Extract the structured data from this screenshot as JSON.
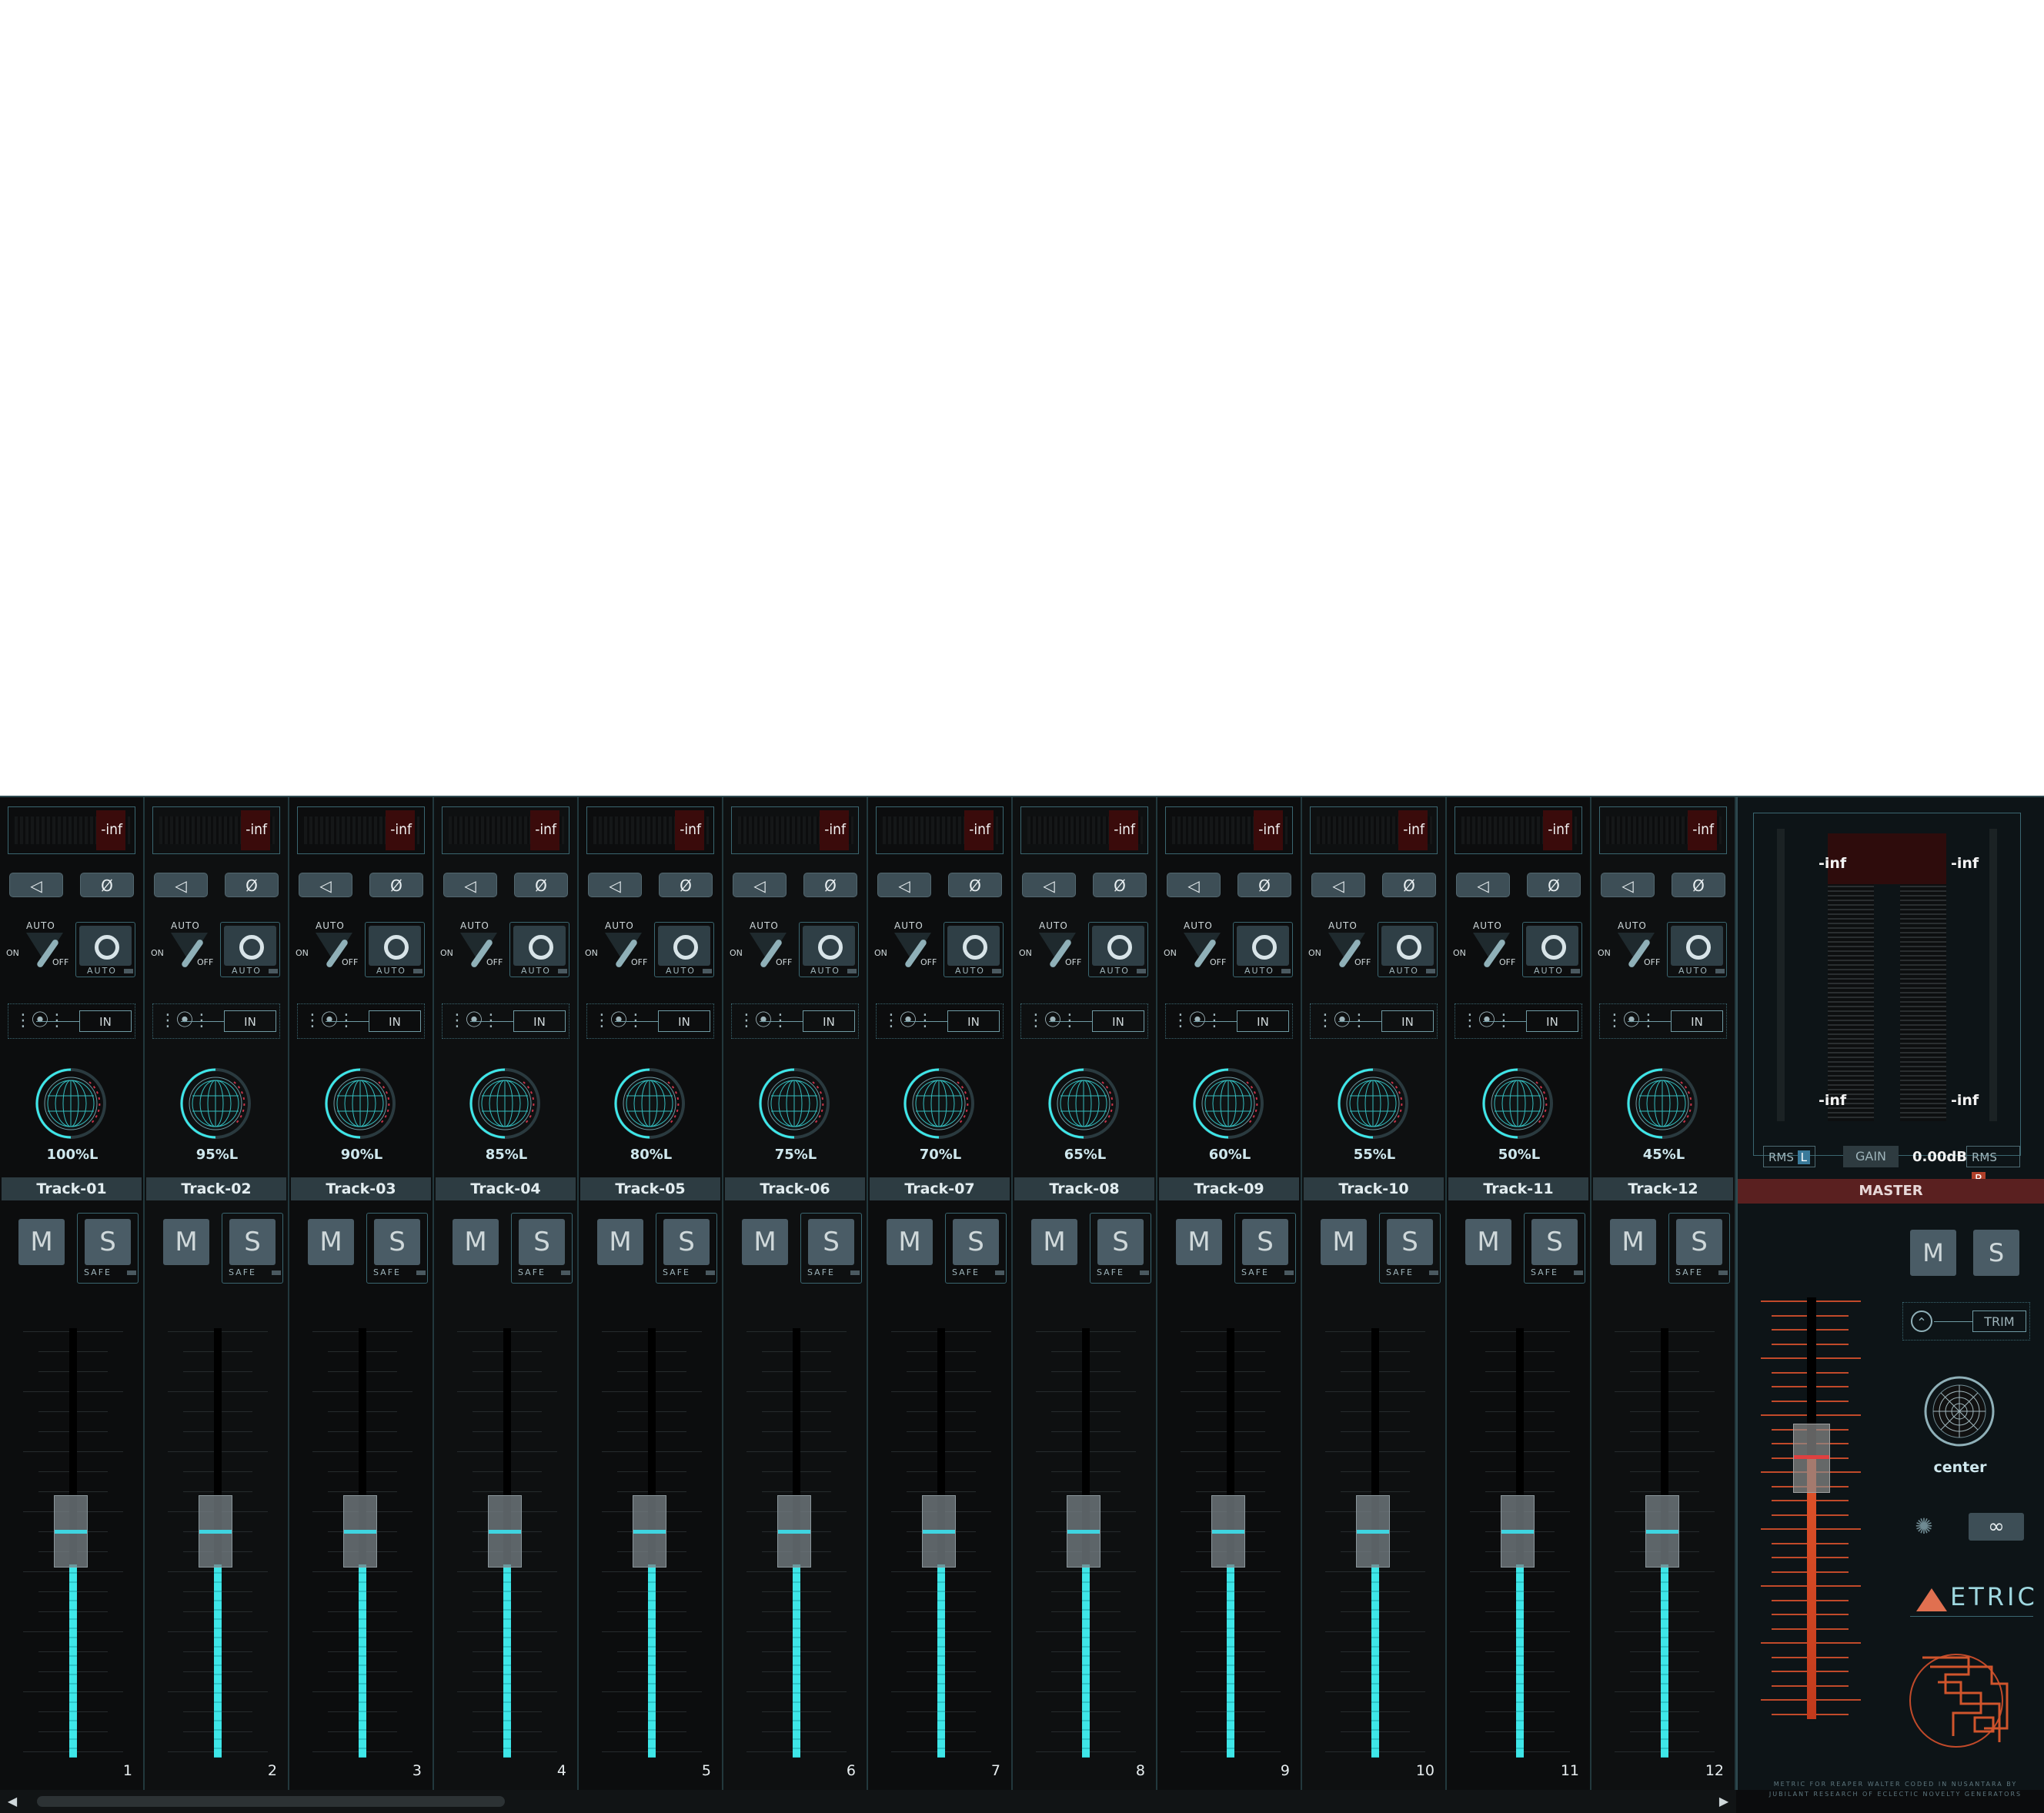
{
  "colors": {
    "accent": "#3ee6e8",
    "panel": "#0c0d0e",
    "button": "#4a5c66",
    "master_accent": "#e0542a",
    "master_header": "#5a2020"
  },
  "icons": {
    "route": "speaker-icon",
    "phase": "phase-invert-icon",
    "fx": "fx-chain-icon",
    "link": "link-icon",
    "trim": "envelope-icon"
  },
  "labels": {
    "auto": "AUTO",
    "on": "ON",
    "off": "OFF",
    "auto_rec": "AUTO",
    "safe": "SAFE",
    "fx_in": "IN",
    "mute": "M",
    "solo": "S",
    "phase_glyph": "Ø",
    "route_glyph": "◁",
    "rec_glyph": ""
  },
  "tracks": [
    {
      "name": "Track-01",
      "number": "1",
      "meter": "-inf",
      "pan": "100%L",
      "fader_level": 0.45
    },
    {
      "name": "Track-02",
      "number": "2",
      "meter": "-inf",
      "pan": "95%L",
      "fader_level": 0.45
    },
    {
      "name": "Track-03",
      "number": "3",
      "meter": "-inf",
      "pan": "90%L",
      "fader_level": 0.45
    },
    {
      "name": "Track-04",
      "number": "4",
      "meter": "-inf",
      "pan": "85%L",
      "fader_level": 0.45
    },
    {
      "name": "Track-05",
      "number": "5",
      "meter": "-inf",
      "pan": "80%L",
      "fader_level": 0.45
    },
    {
      "name": "Track-06",
      "number": "6",
      "meter": "-inf",
      "pan": "75%L",
      "fader_level": 0.45
    },
    {
      "name": "Track-07",
      "number": "7",
      "meter": "-inf",
      "pan": "70%L",
      "fader_level": 0.45
    },
    {
      "name": "Track-08",
      "number": "8",
      "meter": "-inf",
      "pan": "65%L",
      "fader_level": 0.45
    },
    {
      "name": "Track-09",
      "number": "9",
      "meter": "-inf",
      "pan": "60%L",
      "fader_level": 0.45
    },
    {
      "name": "Track-10",
      "number": "10",
      "meter": "-inf",
      "pan": "55%L",
      "fader_level": 0.45
    },
    {
      "name": "Track-11",
      "number": "11",
      "meter": "-inf",
      "pan": "50%L",
      "fader_level": 0.45
    },
    {
      "name": "Track-12",
      "number": "12",
      "meter": "-inf",
      "pan": "45%L",
      "fader_level": 0.45
    }
  ],
  "master": {
    "name": "MASTER",
    "meter_left_peak": "-inf",
    "meter_right_peak": "-inf",
    "meter_left_rms": "-inf",
    "meter_right_rms": "-inf",
    "rms_label": "RMS",
    "rms_left_badge": "L",
    "rms_right_badge": "R",
    "gain_label": "GAIN",
    "gain_value": "0.00dB",
    "mute": "M",
    "solo": "S",
    "trim_label": "TRIM",
    "pan": "center",
    "link_glyph": "∞",
    "fader_level": 0.62,
    "logo_text": "ETRIC",
    "credit_line1": "METRIC FOR REAPER WALTER CODED IN NUSANTARA BY",
    "credit_line2": "JUBILANT RESEARCH OF ECLECTIC NOVELTY GENERATORS"
  },
  "scrollbar": {
    "left_arrow": "◀",
    "right_arrow": "▶"
  }
}
